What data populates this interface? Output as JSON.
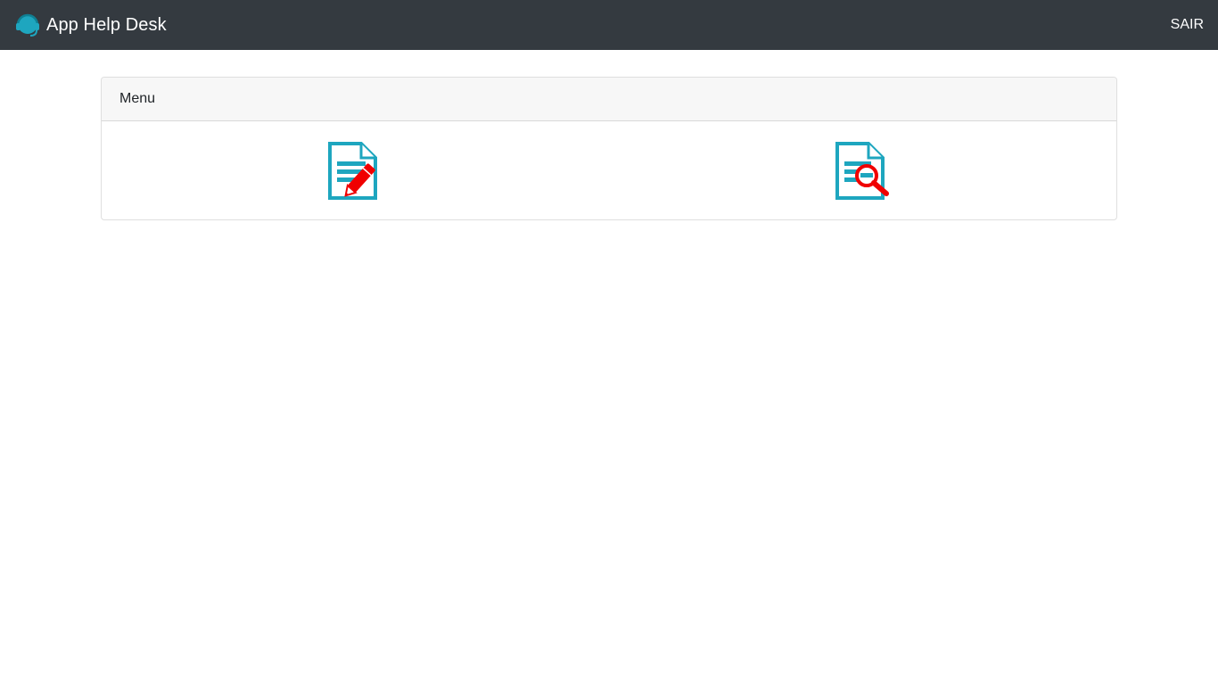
{
  "navbar": {
    "brand_text": "App Help Desk",
    "brand_icon": "headset-icon",
    "logout_label": "SAIR",
    "background_color": "#343a40"
  },
  "menu": {
    "header": "Menu",
    "items": [
      {
        "icon": "document-edit-icon",
        "action": "open-ticket"
      },
      {
        "icon": "document-search-icon",
        "action": "consult-ticket"
      }
    ]
  },
  "colors": {
    "icon_teal": "#1ea6bf",
    "icon_red": "#f00000"
  }
}
